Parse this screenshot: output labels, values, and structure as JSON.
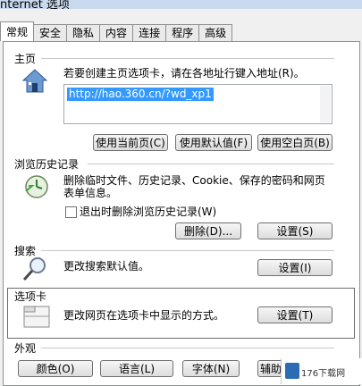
{
  "window": {
    "title": "nternet 选项"
  },
  "tabs": [
    {
      "label": "常规",
      "active": true
    },
    {
      "label": "安全"
    },
    {
      "label": "隐私"
    },
    {
      "label": "内容"
    },
    {
      "label": "连接"
    },
    {
      "label": "程序"
    },
    {
      "label": "高级"
    }
  ],
  "home": {
    "group_label": "主页",
    "description": "若要创建主页选项卡，请在各地址行键入地址(R)。",
    "url": "http://hao.360.cn/?wd_xp1",
    "btn_current": "使用当前页(C)",
    "btn_default": "使用默认值(F)",
    "btn_blank": "使用空白页(B)"
  },
  "history": {
    "group_label": "浏览历史记录",
    "description_line1": "删除临时文件、历史记录、Cookie、保存的密码和网页",
    "description_line2": "表单信息。",
    "checkbox_label": "退出时删除浏览历史记录(W)",
    "btn_delete": "删除(D)...",
    "btn_settings": "设置(S)"
  },
  "search": {
    "group_label": "搜索",
    "description": "更改搜索默认值。",
    "btn_settings": "设置(I)"
  },
  "tabs_group": {
    "group_label": "选项卡",
    "description": "更改网页在选项卡中显示的方式。",
    "btn_settings": "设置(T)"
  },
  "appearance": {
    "group_label": "外观",
    "btn_colors": "颜色(O)",
    "btn_language": "语言(L)",
    "btn_fonts": "字体(N)",
    "btn_accessibility": "辅助"
  },
  "watermark": {
    "text": "176下载网"
  }
}
